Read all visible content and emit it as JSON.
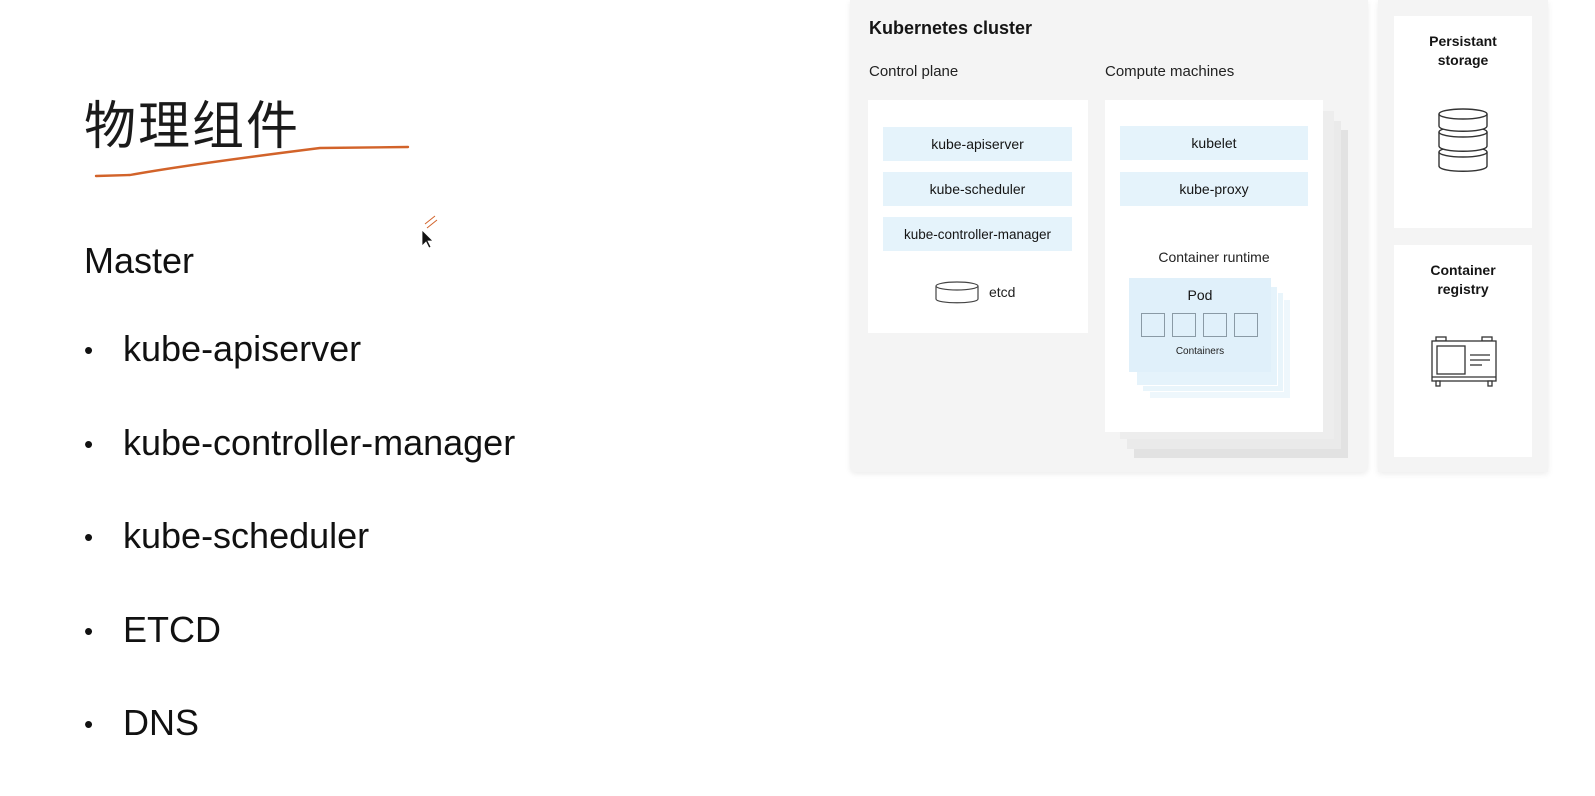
{
  "slide": {
    "title": "物理组件",
    "heading": "Master",
    "bullets": [
      "kube-apiserver",
      "kube-controller-manager",
      "kube-scheduler",
      "ETCD",
      "DNS"
    ],
    "bullet_char": "•",
    "underline_color": "#d2632a"
  },
  "diagram": {
    "cluster_title": "Kubernetes cluster",
    "control_plane": {
      "label": "Control plane",
      "components": [
        "kube-apiserver",
        "kube-scheduler",
        "kube-controller-manager"
      ],
      "etcd_label": "etcd"
    },
    "compute": {
      "label": "Compute machines",
      "components": [
        "kubelet",
        "kube-proxy"
      ],
      "runtime_label": "Container runtime",
      "pod_label": "Pod",
      "containers_label": "Containers"
    },
    "storage": {
      "title_line1": "Persistant",
      "title_line2": "storage"
    },
    "registry": {
      "title_line1": "Container",
      "title_line2": "registry"
    },
    "colors": {
      "panel_bg": "#f4f4f4",
      "component_bg": "#e5f3fb",
      "stack_shadow": "#e2e2e2"
    }
  }
}
